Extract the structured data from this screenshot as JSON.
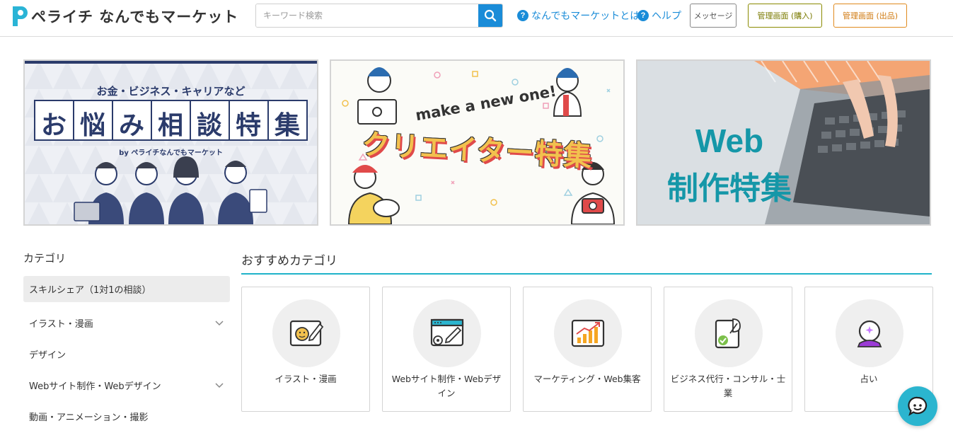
{
  "header": {
    "logo_text": "ペライチ なんでもマーケット",
    "search_placeholder": "キーワード検索",
    "about_link": "なんでもマーケットとは",
    "help_link": "ヘルプ",
    "message_button": "メッセージ",
    "buy_admin_button": "管理画面 (購入)",
    "sell_admin_button": "管理画面 (出品)"
  },
  "banners": [
    {
      "sub": "お金・ビジネス・キャリアなど",
      "title": "お悩み相談特集",
      "byline_prefix": "by",
      "byline_brand": "ペライチなんでもマーケット"
    },
    {
      "sub": "make a new one!",
      "title": "クリエイター特集"
    },
    {
      "title_line1": "Web",
      "title_line2": "制作特集"
    }
  ],
  "sidebar": {
    "title": "カテゴリ",
    "items": [
      {
        "label": "スキルシェア（1対1の相談）",
        "active": true,
        "expandable": false
      },
      {
        "label": "イラスト・漫画",
        "active": false,
        "expandable": true
      },
      {
        "label": "デザイン",
        "active": false,
        "expandable": false
      },
      {
        "label": "Webサイト制作・Webデザイン",
        "active": false,
        "expandable": true
      },
      {
        "label": "動画・アニメーション・撮影",
        "active": false,
        "expandable": false
      }
    ]
  },
  "recommended": {
    "title": "おすすめカテゴリ",
    "cards": [
      {
        "label": "イラスト・漫画",
        "icon": "illustration-icon"
      },
      {
        "label": "Webサイト制作・Webデザイン",
        "icon": "web-design-icon"
      },
      {
        "label": "マーケティング・Web集客",
        "icon": "marketing-chart-icon"
      },
      {
        "label": "ビジネス代行・コンサル・士業",
        "icon": "business-consult-icon"
      },
      {
        "label": "占い",
        "icon": "crystal-ball-icon"
      }
    ]
  },
  "colors": {
    "accent_blue": "#1a8cd8",
    "teal": "#1fb3c9",
    "olive": "#7a7a00",
    "orange": "#d07a10"
  }
}
